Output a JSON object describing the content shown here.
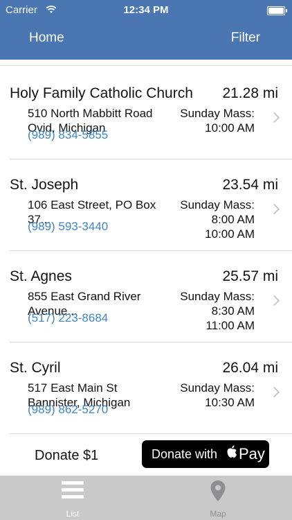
{
  "status_bar": {
    "carrier": "Carrier",
    "time": "12:34 PM"
  },
  "nav": {
    "home_label": "Home",
    "filter_label": "Filter"
  },
  "churches": [
    {
      "name": "Holy Family Catholic Church",
      "distance": "21.28 mi",
      "address_line1": "510 North Mabbitt Road",
      "address_line2": "Ovid, Michigan",
      "phone": "(989) 834-5855",
      "mass_label": "Sunday Mass:",
      "mass_times": [
        "10:00 AM"
      ]
    },
    {
      "name": "St. Joseph",
      "distance": "23.54 mi",
      "address_line1": "106 East Street, PO Box",
      "address_line2": "37...",
      "phone": "(989) 593-3440",
      "mass_label": "Sunday Mass:",
      "mass_times": [
        "8:00 AM",
        "10:00 AM"
      ]
    },
    {
      "name": "St. Agnes",
      "distance": "25.57 mi",
      "address_line1": "855 East Grand River",
      "address_line2": "Avenue...",
      "phone": "(517) 223-8684",
      "mass_label": "Sunday Mass:",
      "mass_times": [
        "8:30 AM",
        "11:00 AM"
      ]
    },
    {
      "name": "St. Cyril",
      "distance": "26.04 mi",
      "address_line1": "517 East Main St",
      "address_line2": "Bannister, Michigan",
      "phone": "(989) 862-5270",
      "mass_label": "Sunday Mass:",
      "mass_times": [
        "10:30 AM"
      ]
    }
  ],
  "donate": {
    "label": "Donate $1",
    "apple_pay_text": "Donate with",
    "apple_pay_brand": "Pay"
  },
  "tabs": {
    "list_label": "List",
    "map_label": "Map"
  },
  "colors": {
    "header": "#4a76b2",
    "link": "#3d86c6",
    "tabbar": "#c9c9c9"
  }
}
